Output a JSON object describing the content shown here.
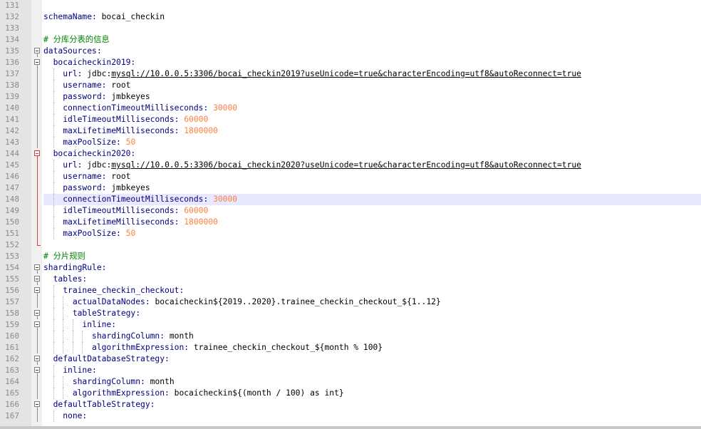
{
  "editor": {
    "colors": {
      "gutter": "#e4e4e4",
      "keyword": "#000080",
      "number": "#ff8040",
      "comment": "#008000",
      "current_line": "#e8e8ff",
      "fold_active": "#d04040"
    },
    "current_line": 148,
    "lines": [
      {
        "num": "131",
        "fold": "none",
        "indent": 0,
        "tokens": []
      },
      {
        "num": "132",
        "fold": "none",
        "indent": 0,
        "tokens": [
          {
            "t": "schemaName:",
            "c": "key"
          },
          {
            "t": " bocai_checkin"
          }
        ]
      },
      {
        "num": "133",
        "fold": "none",
        "indent": 0,
        "tokens": []
      },
      {
        "num": "134",
        "fold": "none",
        "indent": 0,
        "tokens": [
          {
            "t": "# 分库分表的信息",
            "c": "cmt"
          }
        ]
      },
      {
        "num": "135",
        "fold": "box",
        "indent": 0,
        "tokens": [
          {
            "t": "dataSources:",
            "c": "key"
          }
        ]
      },
      {
        "num": "136",
        "fold": "box",
        "indent": 1,
        "tokens": [
          {
            "t": "bocaicheckin2019:",
            "c": "key"
          }
        ]
      },
      {
        "num": "137",
        "fold": "line",
        "indent": 2,
        "tokens": [
          {
            "t": "url:",
            "c": "key"
          },
          {
            "t": " jdbc:"
          },
          {
            "t": "mysql://10.0.0.5:3306/bocai_checkin2019?useUnicode=true&characterEncoding=utf8&autoReconnect=true",
            "c": "url"
          }
        ]
      },
      {
        "num": "138",
        "fold": "line",
        "indent": 2,
        "tokens": [
          {
            "t": "username:",
            "c": "key"
          },
          {
            "t": " root"
          }
        ]
      },
      {
        "num": "139",
        "fold": "line",
        "indent": 2,
        "tokens": [
          {
            "t": "password:",
            "c": "key"
          },
          {
            "t": " jmbkeyes"
          }
        ]
      },
      {
        "num": "140",
        "fold": "line",
        "indent": 2,
        "tokens": [
          {
            "t": "connectionTimeoutMilliseconds:",
            "c": "key"
          },
          {
            "t": " 30000",
            "c": "num"
          }
        ]
      },
      {
        "num": "141",
        "fold": "line",
        "indent": 2,
        "tokens": [
          {
            "t": "idleTimeoutMilliseconds:",
            "c": "key"
          },
          {
            "t": " 60000",
            "c": "num"
          }
        ]
      },
      {
        "num": "142",
        "fold": "line",
        "indent": 2,
        "tokens": [
          {
            "t": "maxLifetimeMilliseconds:",
            "c": "key"
          },
          {
            "t": " 1800000",
            "c": "num"
          }
        ]
      },
      {
        "num": "143",
        "fold": "line",
        "indent": 2,
        "tokens": [
          {
            "t": "maxPoolSize:",
            "c": "key"
          },
          {
            "t": " 50",
            "c": "num"
          }
        ]
      },
      {
        "num": "144",
        "fold": "box-red",
        "indent": 1,
        "tokens": [
          {
            "t": "bocaicheckin2020:",
            "c": "key"
          }
        ]
      },
      {
        "num": "145",
        "fold": "line-red",
        "indent": 2,
        "tokens": [
          {
            "t": "url:",
            "c": "key"
          },
          {
            "t": " jdbc:"
          },
          {
            "t": "mysql://10.0.0.5:3306/bocai_checkin2020?useUnicode=true&characterEncoding=utf8&autoReconnect=true",
            "c": "url"
          }
        ]
      },
      {
        "num": "146",
        "fold": "line-red",
        "indent": 2,
        "tokens": [
          {
            "t": "username:",
            "c": "key"
          },
          {
            "t": " root"
          }
        ]
      },
      {
        "num": "147",
        "fold": "line-red",
        "indent": 2,
        "tokens": [
          {
            "t": "password:",
            "c": "key"
          },
          {
            "t": " jmbkeyes"
          }
        ]
      },
      {
        "num": "148",
        "fold": "line-red",
        "indent": 2,
        "tokens": [
          {
            "t": "connectionTimeoutMilliseconds:",
            "c": "key"
          },
          {
            "t": " 30000",
            "c": "num"
          }
        ]
      },
      {
        "num": "149",
        "fold": "line-red",
        "indent": 2,
        "tokens": [
          {
            "t": "idleTimeoutMilliseconds:",
            "c": "key"
          },
          {
            "t": " 60000",
            "c": "num"
          }
        ]
      },
      {
        "num": "150",
        "fold": "line-red",
        "indent": 2,
        "tokens": [
          {
            "t": "maxLifetimeMilliseconds:",
            "c": "key"
          },
          {
            "t": " 1800000",
            "c": "num"
          }
        ]
      },
      {
        "num": "151",
        "fold": "line-red",
        "indent": 2,
        "tokens": [
          {
            "t": "maxPoolSize:",
            "c": "key"
          },
          {
            "t": " 50",
            "c": "num"
          }
        ]
      },
      {
        "num": "152",
        "fold": "end-red",
        "indent": 0,
        "tokens": []
      },
      {
        "num": "153",
        "fold": "none",
        "indent": 0,
        "tokens": [
          {
            "t": "# 分片规则",
            "c": "cmt"
          }
        ]
      },
      {
        "num": "154",
        "fold": "box",
        "indent": 0,
        "tokens": [
          {
            "t": "shardingRule:",
            "c": "key"
          }
        ]
      },
      {
        "num": "155",
        "fold": "box",
        "indent": 1,
        "tokens": [
          {
            "t": "tables:",
            "c": "key"
          }
        ]
      },
      {
        "num": "156",
        "fold": "box",
        "indent": 2,
        "tokens": [
          {
            "t": "trainee_checkin_checkout:",
            "c": "key"
          }
        ]
      },
      {
        "num": "157",
        "fold": "line",
        "indent": 3,
        "tokens": [
          {
            "t": "actualDataNodes:",
            "c": "key"
          },
          {
            "t": " bocaicheckin${2019..2020}.trainee_checkin_checkout_${1..12}"
          }
        ]
      },
      {
        "num": "158",
        "fold": "box",
        "indent": 3,
        "tokens": [
          {
            "t": "tableStrategy:",
            "c": "key"
          }
        ]
      },
      {
        "num": "159",
        "fold": "box",
        "indent": 4,
        "tokens": [
          {
            "t": "inline:",
            "c": "key"
          }
        ]
      },
      {
        "num": "160",
        "fold": "line",
        "indent": 5,
        "tokens": [
          {
            "t": "shardingColumn:",
            "c": "key"
          },
          {
            "t": " month"
          }
        ]
      },
      {
        "num": "161",
        "fold": "line",
        "indent": 5,
        "tokens": [
          {
            "t": "algorithmExpression:",
            "c": "key"
          },
          {
            "t": " trainee_checkin_checkout_${month % 100}"
          }
        ]
      },
      {
        "num": "162",
        "fold": "box",
        "indent": 1,
        "tokens": [
          {
            "t": "defaultDatabaseStrategy:",
            "c": "key"
          }
        ]
      },
      {
        "num": "163",
        "fold": "box",
        "indent": 2,
        "tokens": [
          {
            "t": "inline:",
            "c": "key"
          }
        ]
      },
      {
        "num": "164",
        "fold": "line",
        "indent": 3,
        "tokens": [
          {
            "t": "shardingColumn:",
            "c": "key"
          },
          {
            "t": " month"
          }
        ]
      },
      {
        "num": "165",
        "fold": "line",
        "indent": 3,
        "tokens": [
          {
            "t": "algorithmExpression:",
            "c": "key"
          },
          {
            "t": " bocaicheckin${(month / 100) as int}"
          }
        ]
      },
      {
        "num": "166",
        "fold": "box",
        "indent": 1,
        "tokens": [
          {
            "t": "defaultTableStrategy:",
            "c": "key"
          }
        ]
      },
      {
        "num": "167",
        "fold": "line",
        "indent": 2,
        "tokens": [
          {
            "t": "none:",
            "c": "key"
          }
        ]
      }
    ]
  }
}
